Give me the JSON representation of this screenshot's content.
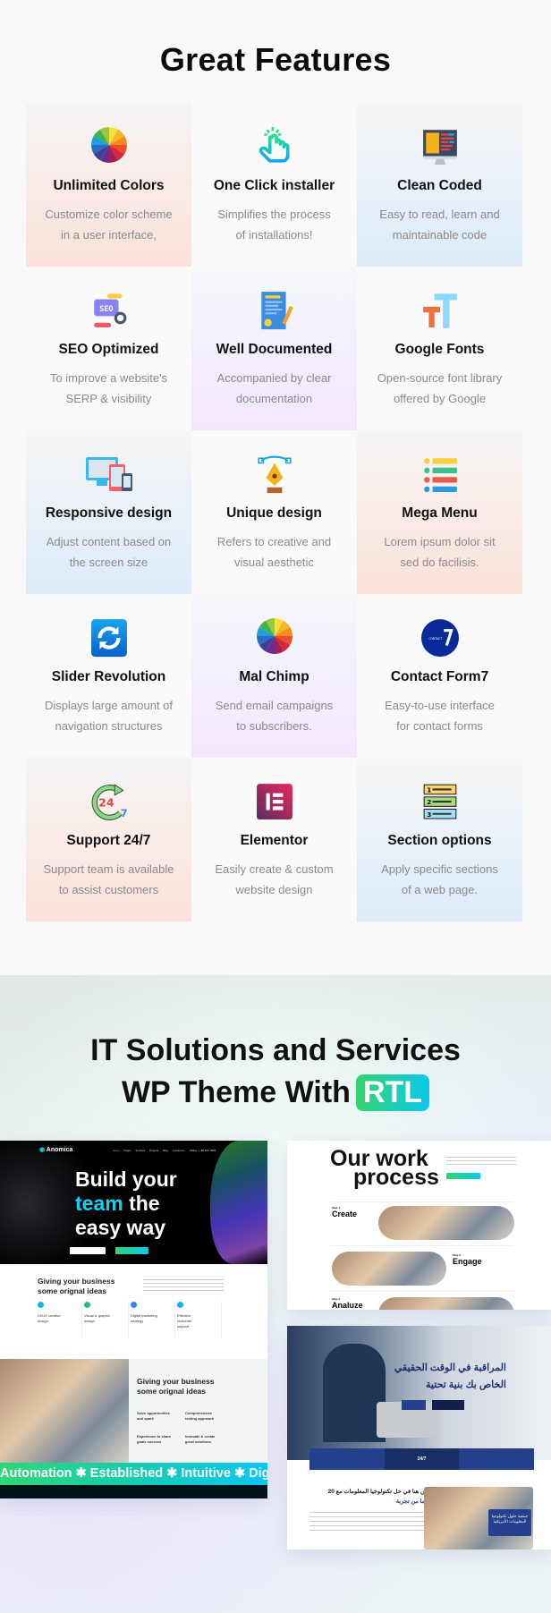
{
  "features": {
    "title": "Great Features",
    "items": [
      {
        "title": "Unlimited Colors",
        "desc1": "Customize color scheme",
        "desc2": "in a user interface,",
        "icon": "color-wheel-icon",
        "bg": "peach"
      },
      {
        "title": "One Click installer",
        "desc1": "Simplifies the process",
        "desc2": "of installations!",
        "icon": "tap-hand-icon",
        "bg": "plain"
      },
      {
        "title": "Clean Coded",
        "desc1": "Easy to read, learn and",
        "desc2": "maintainable code",
        "icon": "code-monitor-icon",
        "bg": "blue"
      },
      {
        "title": "SEO Optimized",
        "desc1": "To improve a website's",
        "desc2": "SERP & visibility",
        "icon": "seo-icon",
        "bg": "plain"
      },
      {
        "title": "Well Documented",
        "desc1": "Accompanied by clear",
        "desc2": "documentation",
        "icon": "document-icon",
        "bg": "lav"
      },
      {
        "title": "Google Fonts",
        "desc1": "Open-source font library",
        "desc2": "offered by Google",
        "icon": "font-icon",
        "bg": "plain"
      },
      {
        "title": "Responsive design",
        "desc1": "Adjust content based on",
        "desc2": "the screen size",
        "icon": "devices-icon",
        "bg": "blue"
      },
      {
        "title": "Unique design",
        "desc1": "Refers to creative and",
        "desc2": "visual aesthetic",
        "icon": "pen-tool-icon",
        "bg": "plain"
      },
      {
        "title": "Mega Menu",
        "desc1": "Lorem ipsum dolor sit",
        "desc2": "sed do facilisis.",
        "icon": "list-menu-icon",
        "bg": "peach"
      },
      {
        "title": "Slider Revolution",
        "desc1": "Displays large amount of",
        "desc2": "navigation structures",
        "icon": "refresh-icon",
        "bg": "plain"
      },
      {
        "title": "Mal Chimp",
        "desc1": "Send email campaigns",
        "desc2": "to subscribers.",
        "icon": "color-wheel-icon",
        "bg": "lav"
      },
      {
        "title": "Contact Form7",
        "desc1": "Easy-to-use interface",
        "desc2": "for contact forms",
        "icon": "contact-form-icon",
        "bg": "plain"
      },
      {
        "title": "Support 24/7",
        "desc1": "Support team is available",
        "desc2": "to assist customers",
        "icon": "support-247-icon",
        "bg": "peach"
      },
      {
        "title": "Elementor",
        "desc1": "Easily create & custom",
        "desc2": "website design",
        "icon": "elementor-icon",
        "bg": "plain"
      },
      {
        "title": "Section options",
        "desc1": "Apply specific sections",
        "desc2": "of a web page.",
        "icon": "sections-icon",
        "bg": "blue"
      }
    ]
  },
  "showcase": {
    "line1": "IT Solutions and Services",
    "line2": "WP Theme With",
    "badge": "RTL",
    "colors": {
      "badge_start": "#33d56c",
      "badge_end": "#0bc8f0",
      "accent": "#11d3f0"
    },
    "demo1": {
      "logo": "Anomica",
      "nav": [
        "Home",
        "Pages",
        "Services",
        "Projects",
        "Blog",
        "Contact Us",
        "Tollfree: (+88 456 7890)"
      ],
      "hero1": "Build your",
      "hero_accent": "team",
      "hero2": "the",
      "hero3": "easy way",
      "section_title1": "Giving your business",
      "section_title2": "some orignal ideas",
      "services": [
        "UI/UX creative design",
        "Visual & graphic design",
        "Digital marketing strategy",
        "Effective customer support"
      ],
      "about_title1": "Giving your business",
      "about_title2": "some orignal ideas",
      "points": [
        "Seize opportunities and spark",
        "Comprehensive testing approach",
        "Experience to share goals success",
        "Innovate & create great solutions."
      ],
      "marquee": "Automation ✱ Established ✱ Intuitive ✱ Digital Ma"
    },
    "demo2": {
      "title1": "Our work",
      "title2": "process",
      "steps": [
        {
          "label": "Step 1",
          "name": "Create"
        },
        {
          "label": "Step 2",
          "name": "Engage"
        },
        {
          "label": "Step 3",
          "name": "Analuze"
        }
      ]
    },
    "demo3": {
      "heading1": "المراقبة في الوقت الحقيقي",
      "heading2": "الخاص بك بنية تحتية",
      "stat": "24/7",
      "about1": "نحن هنا في حل تكنولوجيا المعلومات مع 20",
      "about2": "عاما من تجربة",
      "badge": "جمعية حلول تكنولوجيا المعلومات الأمريكية"
    }
  }
}
